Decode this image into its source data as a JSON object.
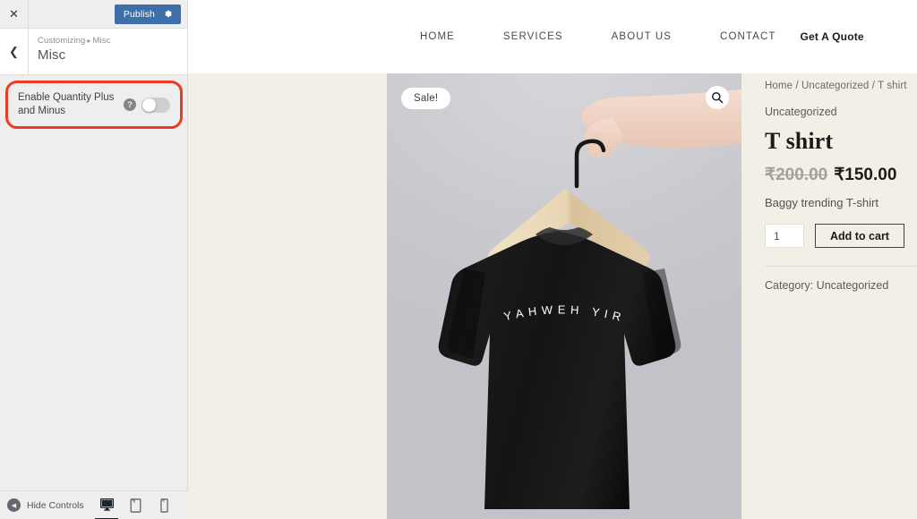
{
  "customizer": {
    "close_icon": "close-icon",
    "publish_label": "Publish",
    "publish_gear_icon": "gear-icon",
    "back_icon": "chevron-left-icon",
    "breadcrumb_prefix": "Customizing",
    "breadcrumb_sep": "▸",
    "breadcrumb_section": "Misc",
    "panel_title": "Misc",
    "controls": [
      {
        "label": "Enable Quantity Plus and Minus",
        "help_icon": "help-icon",
        "help_glyph": "?",
        "toggle_state": "off",
        "highlighted": true,
        "highlight_color": "#ee3a20"
      }
    ],
    "footer": {
      "hide_controls_label": "Hide Controls",
      "collapse_icon": "collapse-arrow-icon",
      "devices": [
        {
          "name": "desktop-preview",
          "icon": "desktop-icon",
          "active": true
        },
        {
          "name": "tablet-preview",
          "icon": "tablet-icon",
          "active": false
        },
        {
          "name": "mobile-preview",
          "icon": "mobile-icon",
          "active": false
        }
      ]
    },
    "accent_color": "#3f6fa8"
  },
  "site": {
    "nav": [
      {
        "label": "HOME"
      },
      {
        "label": "SERVICES"
      },
      {
        "label": "ABOUT US"
      },
      {
        "label": "CONTACT"
      }
    ],
    "cta_label": "Get A Quote",
    "product": {
      "sale_badge": "Sale!",
      "zoom_icon": "search-icon",
      "image_alt": "black t-shirt on wooden hanger held by a hand",
      "shirt_print": "YAHWEH YIREH",
      "breadcrumb": {
        "home": "Home",
        "category": "Uncategorized",
        "current": "T shirt",
        "separator": "/"
      },
      "category_line": "Uncategorized",
      "title": "T shirt",
      "price_old": "₹200.00",
      "price_new": "₹150.00",
      "description": "Baggy trending T-shirt",
      "quantity_value": "1",
      "add_to_cart_label": "Add to cart",
      "meta_category": "Category: Uncategorized",
      "background_color": "#f2f0e6"
    }
  }
}
